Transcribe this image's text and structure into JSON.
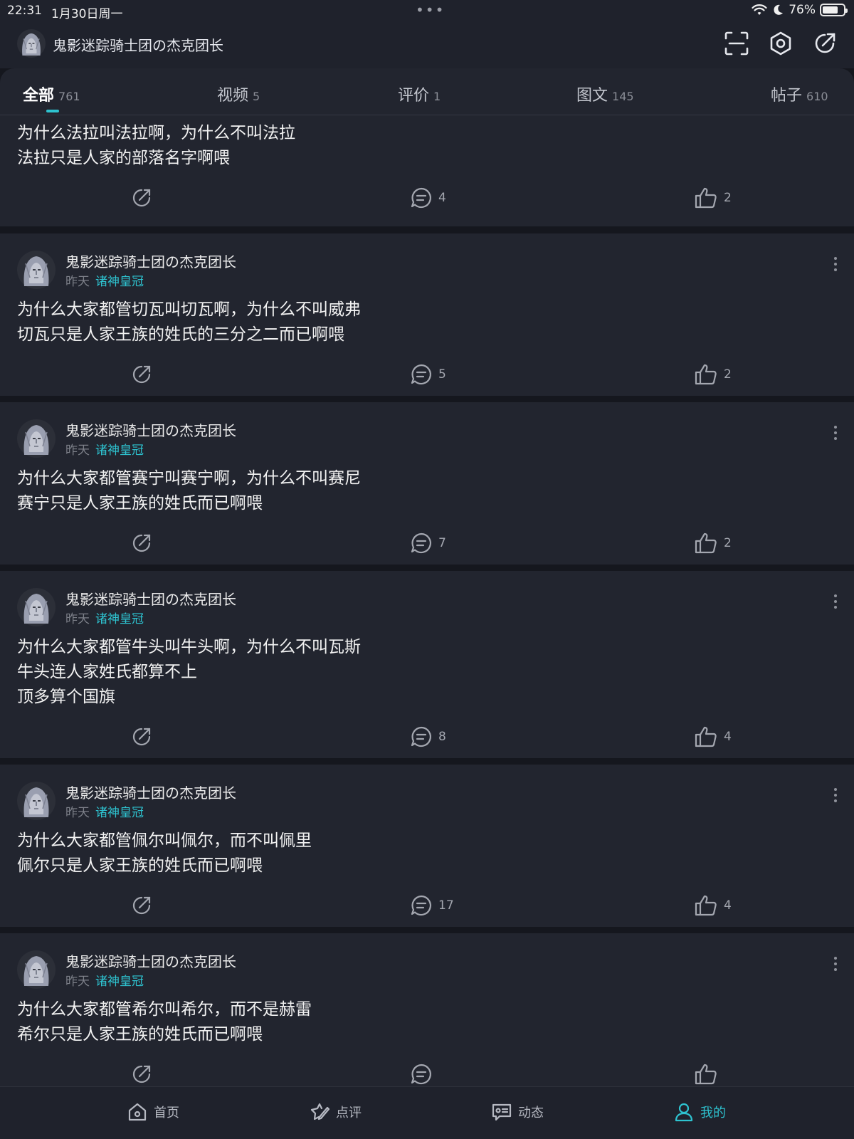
{
  "status": {
    "time": "22:31",
    "date": "1月30日周一",
    "battery": "76%",
    "battery_level": 0.76
  },
  "header": {
    "username": "鬼影迷踪骑士团の杰克团长",
    "icons": [
      "scan-icon",
      "settings-icon",
      "share-icon"
    ]
  },
  "tabs": [
    {
      "label": "全部",
      "count": "761",
      "active": true
    },
    {
      "label": "视频",
      "count": "5"
    },
    {
      "label": "评价",
      "count": "1"
    },
    {
      "label": "图文",
      "count": "145"
    },
    {
      "label": "帖子",
      "count": "610"
    }
  ],
  "posts": [
    {
      "author": "",
      "time": "",
      "tag": "",
      "lines": [
        "为什么法拉叫法拉啊，为什么不叫法拉",
        "法拉只是人家的部落名字啊喂"
      ],
      "comments": "4",
      "likes": "2"
    },
    {
      "author": "鬼影迷踪骑士团の杰克团长",
      "time": "昨天",
      "tag": "诸神皇冠",
      "lines": [
        "为什么大家都管切瓦叫切瓦啊，为什么不叫威弗",
        "切瓦只是人家王族的姓氏的三分之二而已啊喂"
      ],
      "comments": "5",
      "likes": "2"
    },
    {
      "author": "鬼影迷踪骑士团の杰克团长",
      "time": "昨天",
      "tag": "诸神皇冠",
      "lines": [
        "为什么大家都管赛宁叫赛宁啊，为什么不叫赛尼",
        "赛宁只是人家王族的姓氏而已啊喂"
      ],
      "comments": "7",
      "likes": "2"
    },
    {
      "author": "鬼影迷踪骑士团の杰克团长",
      "time": "昨天",
      "tag": "诸神皇冠",
      "lines": [
        "为什么大家都管牛头叫牛头啊，为什么不叫瓦斯",
        "牛头连人家姓氏都算不上",
        "顶多算个国旗"
      ],
      "comments": "8",
      "likes": "4"
    },
    {
      "author": "鬼影迷踪骑士团の杰克团长",
      "time": "昨天",
      "tag": "诸神皇冠",
      "lines": [
        "为什么大家都管佩尔叫佩尔，而不叫佩里",
        "佩尔只是人家王族的姓氏而已啊喂"
      ],
      "comments": "17",
      "likes": "4"
    },
    {
      "author": "鬼影迷踪骑士团の杰克团长",
      "time": "昨天",
      "tag": "诸神皇冠",
      "lines": [
        "为什么大家都管希尔叫希尔，而不是赫雷",
        "希尔只是人家王族的姓氏而已啊喂"
      ],
      "comments": "",
      "likes": ""
    }
  ],
  "nav": [
    {
      "label": "首页",
      "icon": "home-icon"
    },
    {
      "label": "点评",
      "icon": "review-icon"
    },
    {
      "label": "动态",
      "icon": "feed-icon"
    },
    {
      "label": "我的",
      "icon": "profile-icon",
      "active": true
    }
  ],
  "colors": {
    "accent": "#2ec3d0",
    "background": "#15171e",
    "card": "#22252f"
  }
}
